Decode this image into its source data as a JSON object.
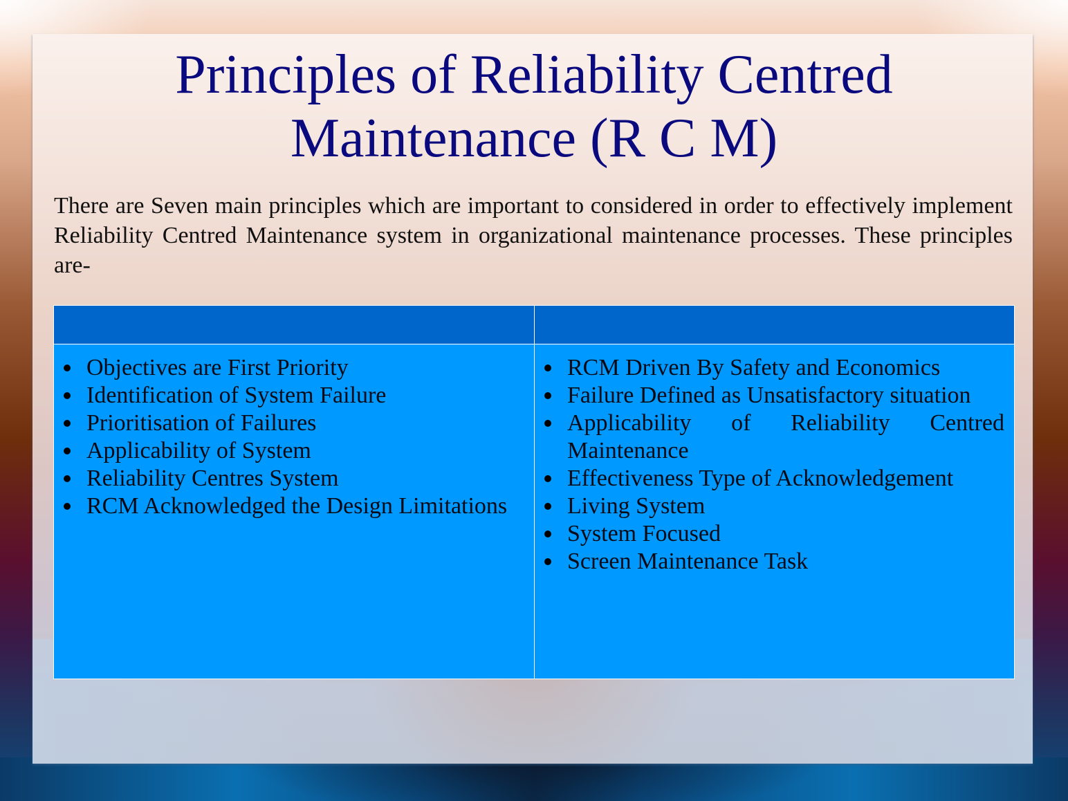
{
  "slide": {
    "title_line1": "Principles of  Reliability Centred",
    "title_line2": "Maintenance (R C M)",
    "intro": "There are Seven main principles which are important to considered in order to effectively implement Reliability Centred Maintenance system in organizational maintenance processes. These principles are-",
    "table": {
      "headers": [
        "",
        ""
      ],
      "left_items": [
        "Objectives are First Priority",
        "Identification of System Failure",
        "Prioritisation of Failures",
        "Applicability of System",
        "Reliability Centres System",
        "RCM Acknowledged the Design Limitations"
      ],
      "right_items": [
        "RCM Driven By Safety and Economics",
        "Failure Defined as Unsatisfactory situation",
        "Applicability of Reliability Centred Maintenance",
        "Effectiveness Type of Acknowledgement",
        "Living System",
        "System Focused",
        "Screen Maintenance Task"
      ]
    },
    "colors": {
      "title": "#0a0a7e",
      "header_fill": "#0066cc",
      "body_fill": "#0099ff"
    },
    "icons": {
      "bullet": "bullet-dot-icon"
    }
  }
}
